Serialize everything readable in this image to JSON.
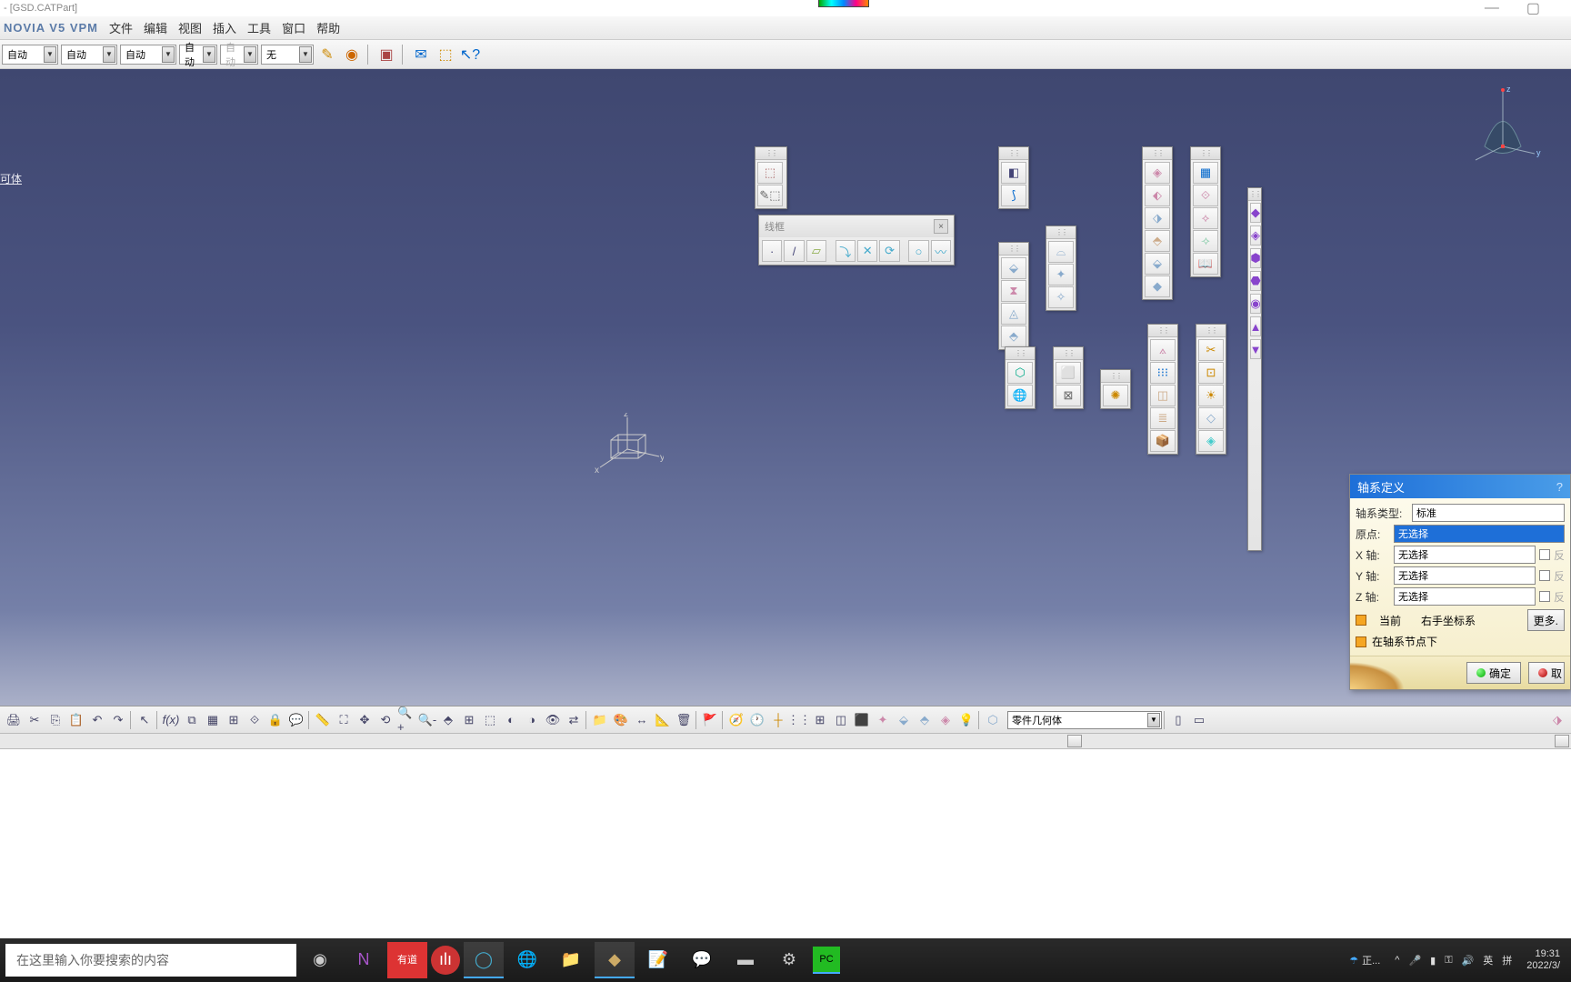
{
  "title": "- [GSD.CATPart]",
  "vpm": "NOVIA V5 VPM",
  "menu": {
    "file": "文件",
    "edit": "编辑",
    "view": "视图",
    "insert": "插入",
    "tools": "工具",
    "window": "窗口",
    "help": "帮助"
  },
  "toolbar_dropdowns": {
    "d0": "自动",
    "d1": "自动",
    "d2": "自动",
    "d3": "自动",
    "d4": "自动",
    "d5": "无"
  },
  "tree_item": "可体",
  "wireframe_title": "线框",
  "dialog": {
    "title": "轴系定义",
    "help": "?",
    "type_label": "轴系类型:",
    "type_value": "标准",
    "origin_label": "原点:",
    "origin_value": "无选择",
    "x_label": "X 轴:",
    "x_value": "无选择",
    "y_label": "Y 轴:",
    "y_value": "无选择",
    "z_label": "Z 轴:",
    "z_value": "无选择",
    "rev": "反",
    "current": "当前",
    "rhcs": "右手坐标系",
    "more": "更多.",
    "under_node": "在轴系节点下",
    "ok": "确定",
    "cancel": "取"
  },
  "bottom_combo": "零件几何体",
  "search_placeholder": "在这里输入你要搜索的内容",
  "tray": {
    "weather_text": "正...",
    "ime1": "英",
    "ime2": "拼",
    "time": "19:31",
    "date": "2022/3/"
  }
}
